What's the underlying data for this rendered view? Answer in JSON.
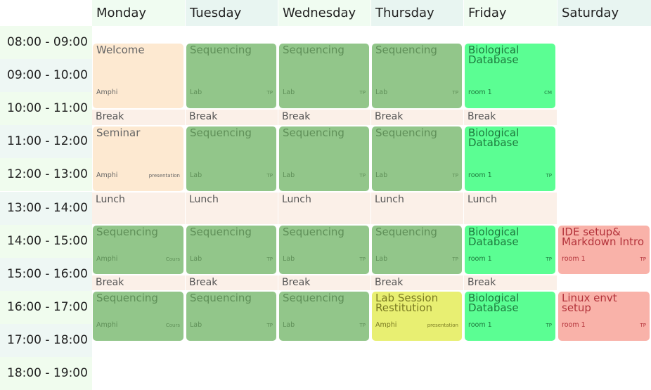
{
  "days": [
    "Monday",
    "Tuesday",
    "Wednesday",
    "Thursday",
    "Friday",
    "Saturday"
  ],
  "times": [
    "08:00 - 09:00",
    "09:00 - 10:00",
    "10:00 - 11:00",
    "11:00 - 12:00",
    "12:00 - 13:00",
    "13:00 - 14:00",
    "14:00 - 15:00",
    "15:00 - 16:00",
    "16:00 - 17:00",
    "17:00 - 18:00",
    "18:00 - 19:00"
  ],
  "colors": {
    "header_bg": "#e8f5f1",
    "time_bg_a": "#eef7f4",
    "time_bg_b": "#f0fcee",
    "welcome": "#fde9d1",
    "seminar": "#fde9d1",
    "sequencing": "#92c68a",
    "bio": "#5bfe93",
    "yellow": "#e8ef72",
    "red": "#f9b2a9",
    "pause": "#fbf0e8"
  },
  "events": [
    {
      "day": 0,
      "slot": "morning1",
      "title": "Welcome",
      "loc": "Amphi",
      "kind": "",
      "color": "welcome",
      "text": "#666"
    },
    {
      "day": 1,
      "slot": "morning1",
      "title": "Sequencing",
      "loc": "Lab",
      "kind": "TP",
      "color": "sequencing",
      "text": "#5f8f58"
    },
    {
      "day": 2,
      "slot": "morning1",
      "title": "Sequencing",
      "loc": "Lab",
      "kind": "TP",
      "color": "sequencing",
      "text": "#5f8f58"
    },
    {
      "day": 3,
      "slot": "morning1",
      "title": "Sequencing",
      "loc": "Lab",
      "kind": "TP",
      "color": "sequencing",
      "text": "#5f8f58"
    },
    {
      "day": 4,
      "slot": "morning1",
      "title": "Biological Database",
      "loc": "room 1",
      "kind": "CM",
      "color": "bio",
      "text": "#1e7a3e"
    },
    {
      "day": 0,
      "slot": "morning2",
      "title": "Seminar",
      "loc": "Amphi",
      "kind": "presentation",
      "color": "seminar",
      "text": "#666"
    },
    {
      "day": 1,
      "slot": "morning2",
      "title": "Sequencing",
      "loc": "Lab",
      "kind": "TP",
      "color": "sequencing",
      "text": "#5f8f58"
    },
    {
      "day": 2,
      "slot": "morning2",
      "title": "Sequencing",
      "loc": "Lab",
      "kind": "TP",
      "color": "sequencing",
      "text": "#5f8f58"
    },
    {
      "day": 3,
      "slot": "morning2",
      "title": "Sequencing",
      "loc": "Lab",
      "kind": "TP",
      "color": "sequencing",
      "text": "#5f8f58"
    },
    {
      "day": 4,
      "slot": "morning2",
      "title": "Biological Database",
      "loc": "room 1",
      "kind": "TP",
      "color": "bio",
      "text": "#1e7a3e"
    },
    {
      "day": 0,
      "slot": "afternoon1",
      "title": "Sequencing",
      "loc": "Amphi",
      "kind": "Cours",
      "color": "sequencing",
      "text": "#5f8f58"
    },
    {
      "day": 1,
      "slot": "afternoon1",
      "title": "Sequencing",
      "loc": "Lab",
      "kind": "TP",
      "color": "sequencing",
      "text": "#5f8f58"
    },
    {
      "day": 2,
      "slot": "afternoon1",
      "title": "Sequencing",
      "loc": "Lab",
      "kind": "TP",
      "color": "sequencing",
      "text": "#5f8f58"
    },
    {
      "day": 3,
      "slot": "afternoon1",
      "title": "Sequencing",
      "loc": "Lab",
      "kind": "TP",
      "color": "sequencing",
      "text": "#5f8f58"
    },
    {
      "day": 4,
      "slot": "afternoon1",
      "title": "Biological Database",
      "loc": "room 1",
      "kind": "TP",
      "color": "bio",
      "text": "#1e7a3e"
    },
    {
      "day": 5,
      "slot": "afternoon1",
      "title": "IDE setup& Markdown Intro",
      "loc": "room 1",
      "kind": "TP",
      "color": "red",
      "text": "#b3323a"
    },
    {
      "day": 0,
      "slot": "afternoon2",
      "title": "Sequencing",
      "loc": "Amphi",
      "kind": "Cours",
      "color": "sequencing",
      "text": "#5f8f58"
    },
    {
      "day": 1,
      "slot": "afternoon2",
      "title": "Sequencing",
      "loc": "Lab",
      "kind": "TP",
      "color": "sequencing",
      "text": "#5f8f58"
    },
    {
      "day": 2,
      "slot": "afternoon2",
      "title": "Sequencing",
      "loc": "Lab",
      "kind": "TP",
      "color": "sequencing",
      "text": "#5f8f58"
    },
    {
      "day": 3,
      "slot": "afternoon2",
      "title": "Lab Session Restitution",
      "loc": "Amphi",
      "kind": "presentation",
      "color": "yellow",
      "text": "#7a7a22"
    },
    {
      "day": 4,
      "slot": "afternoon2",
      "title": "Biological Database",
      "loc": "room 1",
      "kind": "TP",
      "color": "bio",
      "text": "#1e7a3e"
    },
    {
      "day": 5,
      "slot": "afternoon2",
      "title": "Linux envt setup",
      "loc": "room 1",
      "kind": "TP",
      "color": "red",
      "text": "#b3323a"
    }
  ],
  "pauses": [
    {
      "day": 0,
      "slot": "break1",
      "title": "Break"
    },
    {
      "day": 1,
      "slot": "break1",
      "title": "Break"
    },
    {
      "day": 2,
      "slot": "break1",
      "title": "Break"
    },
    {
      "day": 3,
      "slot": "break1",
      "title": "Break"
    },
    {
      "day": 4,
      "slot": "break1",
      "title": "Break"
    },
    {
      "day": 0,
      "slot": "lunch",
      "title": "Lunch"
    },
    {
      "day": 1,
      "slot": "lunch",
      "title": "Lunch"
    },
    {
      "day": 2,
      "slot": "lunch",
      "title": "Lunch"
    },
    {
      "day": 3,
      "slot": "lunch",
      "title": "Lunch"
    },
    {
      "day": 4,
      "slot": "lunch",
      "title": "Lunch"
    },
    {
      "day": 0,
      "slot": "break2",
      "title": "Break"
    },
    {
      "day": 1,
      "slot": "break2",
      "title": "Break"
    },
    {
      "day": 2,
      "slot": "break2",
      "title": "Break"
    },
    {
      "day": 3,
      "slot": "break2",
      "title": "Break"
    },
    {
      "day": 4,
      "slot": "break2",
      "title": "Break"
    }
  ]
}
